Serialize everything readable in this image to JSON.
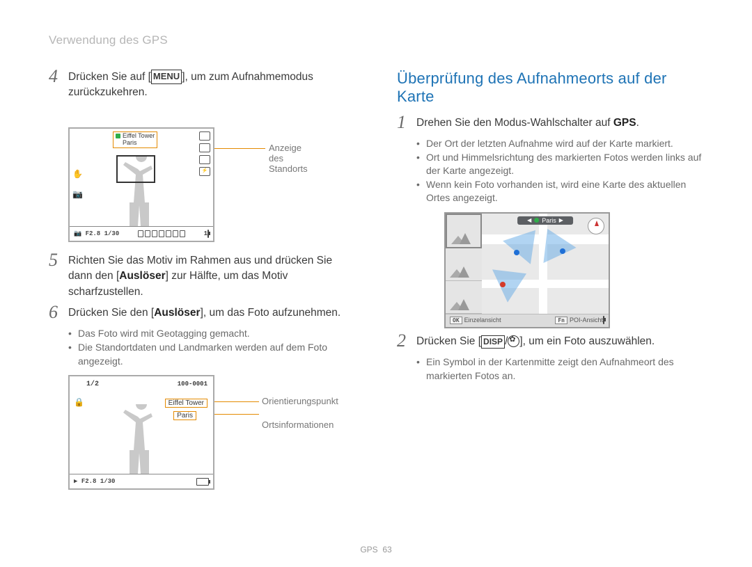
{
  "header": {
    "breadcrumb": "Verwendung des GPS"
  },
  "left": {
    "step4": {
      "num": "4",
      "pre": "Drücken Sie auf [",
      "menu_label": "MENU",
      "post": "], um zum Aufnahmemodus zurückzukehren."
    },
    "callout_location": "Anzeige des Standorts",
    "shot1": {
      "gps_line1": "Eiffel Tower",
      "gps_line2": "Paris",
      "footer_left": "F2.8 1/30",
      "footer_right": "1"
    },
    "step5": {
      "num": "5",
      "text_pre": "Richten Sie das Motiv im Rahmen aus und drücken Sie dann den [",
      "text_bold": "Auslöser",
      "text_post": "] zur Hälfte, um das Motiv scharfzustellen."
    },
    "step6": {
      "num": "6",
      "text_pre": "Drücken Sie den [",
      "text_bold": "Auslöser",
      "text_post": "], um das Foto aufzunehmen."
    },
    "step6_bullets": [
      "Das Foto wird mit Geotagging gemacht.",
      "Die Standortdaten und Landmarken werden auf dem Foto angezeigt."
    ],
    "shot2": {
      "top_left": "1/2",
      "top_right": "100-0001",
      "landmark": "Eiffel Tower",
      "place": "Paris",
      "footer_left": "F2.8 1/30"
    },
    "callout_landmark": "Orientierungspunkt",
    "callout_place": "Ortsinformationen"
  },
  "right": {
    "title": "Überprüfung des Aufnahmeorts auf der Karte",
    "step1": {
      "num": "1",
      "text_pre": "Drehen Sie den Modus-Wahlschalter auf ",
      "text_bold": "GPS",
      "text_post": "."
    },
    "step1_bullets": [
      "Der Ort der letzten Aufnahme wird auf der Karte markiert.",
      "Ort und Himmelsrichtung des markierten Fotos werden links auf der Karte angezeigt.",
      "Wenn kein Foto vorhanden ist, wird eine Karte des aktuellen Ortes angezeigt."
    ],
    "map": {
      "chip": "Paris",
      "footer_ok": "OK",
      "footer_ok_label": "Einzelansicht",
      "footer_fn": "Fn",
      "footer_fn_label": "POI-Ansicht"
    },
    "step2": {
      "num": "2",
      "text_pre": "Drücken Sie [",
      "disp": "DISP",
      "text_mid": "/",
      "text_post": "], um ein Foto auszuwählen."
    },
    "step2_bullets": [
      "Ein Symbol in der Kartenmitte zeigt den Aufnahmeort des markierten Fotos an."
    ]
  },
  "footer": {
    "label": "GPS",
    "page": "63"
  }
}
